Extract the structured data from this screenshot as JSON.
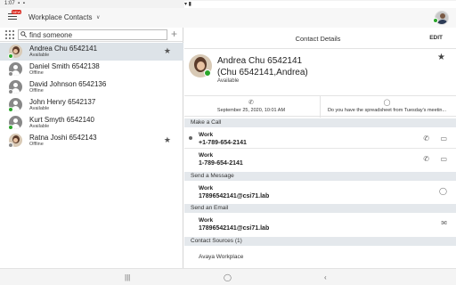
{
  "status_bar": {
    "time": "1:07",
    "right": ""
  },
  "app_bar": {
    "title": "Workplace Contacts",
    "menu_badge": "NEW"
  },
  "search": {
    "value": "find someone"
  },
  "contacts": [
    {
      "name": "Andrea Chu 6542141",
      "status": "Available",
      "favorite": true,
      "selected": true
    },
    {
      "name": "Daniel Smith 6542138",
      "status": "Offline",
      "favorite": false,
      "selected": false
    },
    {
      "name": "David Johnson 6542136",
      "status": "Offline",
      "favorite": false,
      "selected": false
    },
    {
      "name": "John Henry 6542137",
      "status": "Available",
      "favorite": false,
      "selected": false
    },
    {
      "name": "Kurt Smyth 6542140",
      "status": "Available",
      "favorite": false,
      "selected": false
    },
    {
      "name": "Ratna Joshi 6542143",
      "status": "Offline",
      "favorite": true,
      "selected": false
    }
  ],
  "details": {
    "header_title": "Contact Details",
    "edit_label": "EDIT",
    "name": "Andrea Chu 6542141",
    "alias": "(Chu 6542141,Andrea)",
    "status": "Available",
    "recent_call": "September 25, 2020, 10:01 AM",
    "recent_message": "Do you have the spreadsheet from Tuesday's meetin...",
    "sections": {
      "call": "Make a Call",
      "message": "Send a Message",
      "email": "Send an Email",
      "sources": "Contact Sources (1)"
    },
    "call_entries": [
      {
        "label": "Work",
        "value": "+1-789-654-2141"
      },
      {
        "label": "Work",
        "value": "1-789-654-2141"
      }
    ],
    "message_entry": {
      "label": "Work",
      "value": "17896542141@csi71.lab"
    },
    "email_entry": {
      "label": "Work",
      "value": "17896542141@csi71.lab"
    },
    "source": "Avaya Workplace"
  },
  "icons": {
    "menu": "hamburger-icon",
    "dialpad": "dialpad-icon",
    "search": "search-icon",
    "add": "plus-icon",
    "star": "star-icon",
    "phone": "phone-icon",
    "video": "video-icon",
    "chat": "chat-bubble-icon",
    "mail": "mail-icon"
  },
  "colors": {
    "available": "#2aa52a",
    "offline": "#8a8a8a",
    "selected_row": "#dde3e8",
    "section_bg": "#e4e8ec"
  }
}
